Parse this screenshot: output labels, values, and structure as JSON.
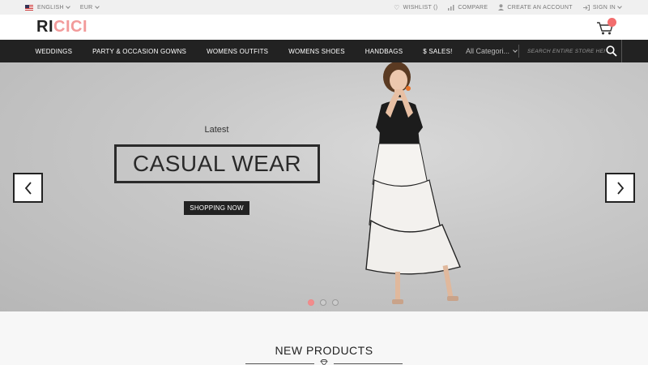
{
  "topbar": {
    "language": "ENGLISH",
    "currency": "EUR",
    "wishlist": "WISHLIST ()",
    "compare": "COMPARE",
    "create_account": "CREATE AN ACCOUNT",
    "sign_in": "SIGN IN"
  },
  "header": {
    "logo_part1": "RI",
    "logo_part2": "CICI"
  },
  "nav": {
    "items": [
      {
        "label": "WEDDINGS"
      },
      {
        "label": "PARTY & OCCASION GOWNS"
      },
      {
        "label": "WOMENS OUTFITS"
      },
      {
        "label": "WOMENS SHOES"
      },
      {
        "label": "HANDBAGS"
      },
      {
        "label": "$ SALES!"
      }
    ],
    "category_select": "All Categori...",
    "search_placeholder": "SEARCH ENTIRE STORE HERE..."
  },
  "hero": {
    "subtitle": "Latest",
    "title": "CASUAL WEAR",
    "button": "SHOPPING NOW",
    "slide_count": 3,
    "active_slide": 1
  },
  "section": {
    "title": "NEW PRODUCTS"
  },
  "colors": {
    "brand_pink": "#f29a9a",
    "nav_bg": "#222222",
    "badge": "#f26d6d"
  }
}
